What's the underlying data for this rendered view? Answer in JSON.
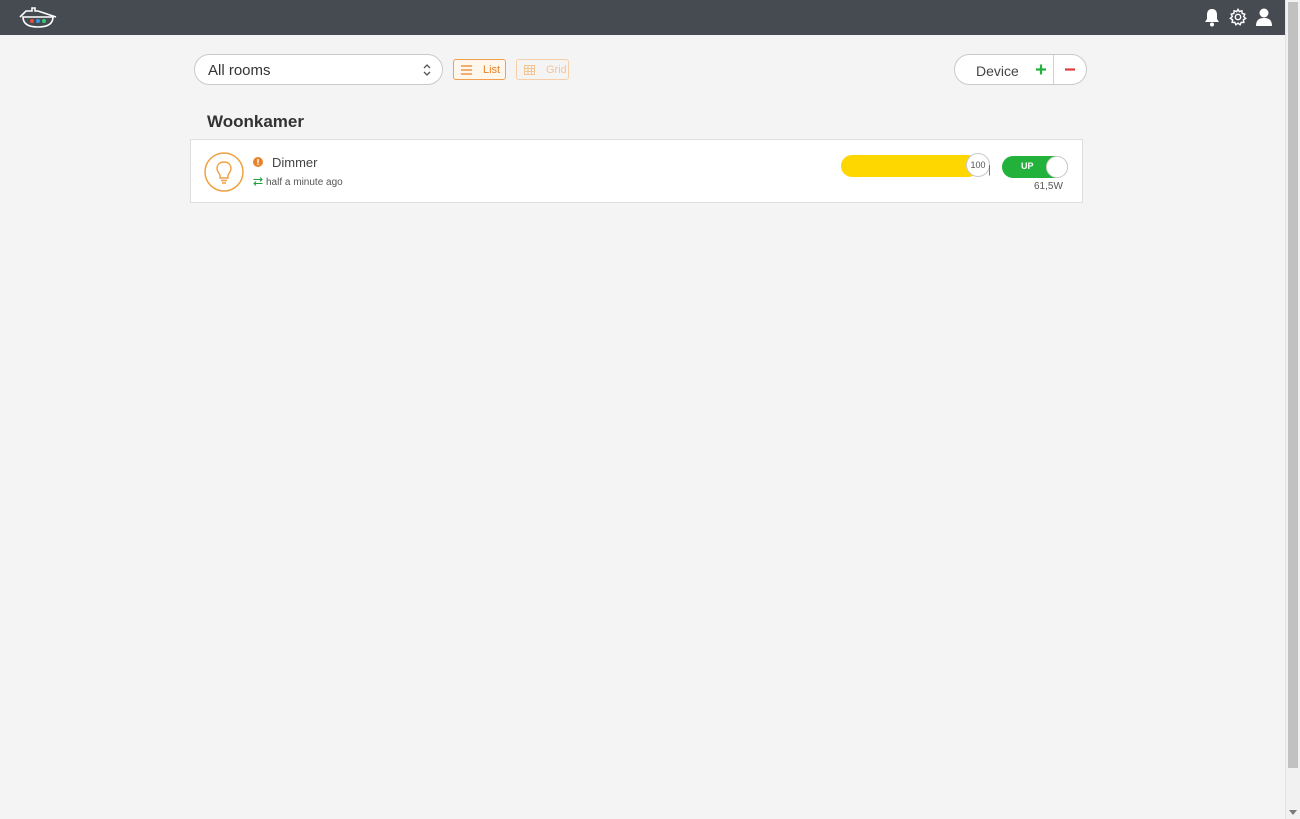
{
  "header": {
    "logo_icon": "house-logo-icon",
    "icons": [
      "bell-icon",
      "gear-icon",
      "user-icon"
    ]
  },
  "toolbar": {
    "room_filter": {
      "selected": "All rooms",
      "icon": "updown-chevron-icon"
    },
    "views": [
      {
        "label": "List",
        "icon": "list-icon",
        "active": true
      },
      {
        "label": "Grid",
        "icon": "grid-icon",
        "active": false
      }
    ],
    "device_group": {
      "label": "Device",
      "add_icon": "plus-icon",
      "remove_icon": "minus-icon"
    }
  },
  "rooms": [
    {
      "name": "Woonkamer",
      "devices": [
        {
          "icon": "lightbulb-icon",
          "status_icon": "warning-icon",
          "name": "Dimmer",
          "sync_icon": "sync-arrows-icon",
          "last_update": "half a minute ago",
          "dim_level": 100,
          "dim_label": "100",
          "separator": "|",
          "switch_label": "UP",
          "switch_on": true,
          "power": "61,5W"
        }
      ]
    }
  ],
  "colors": {
    "topbar": "#464a51",
    "accent_orange": "#e8832a",
    "add_green": "#22b13a",
    "remove_red": "#e03a3a",
    "dimmer_yellow": "#ffd700",
    "switch_green": "#22b13a"
  }
}
